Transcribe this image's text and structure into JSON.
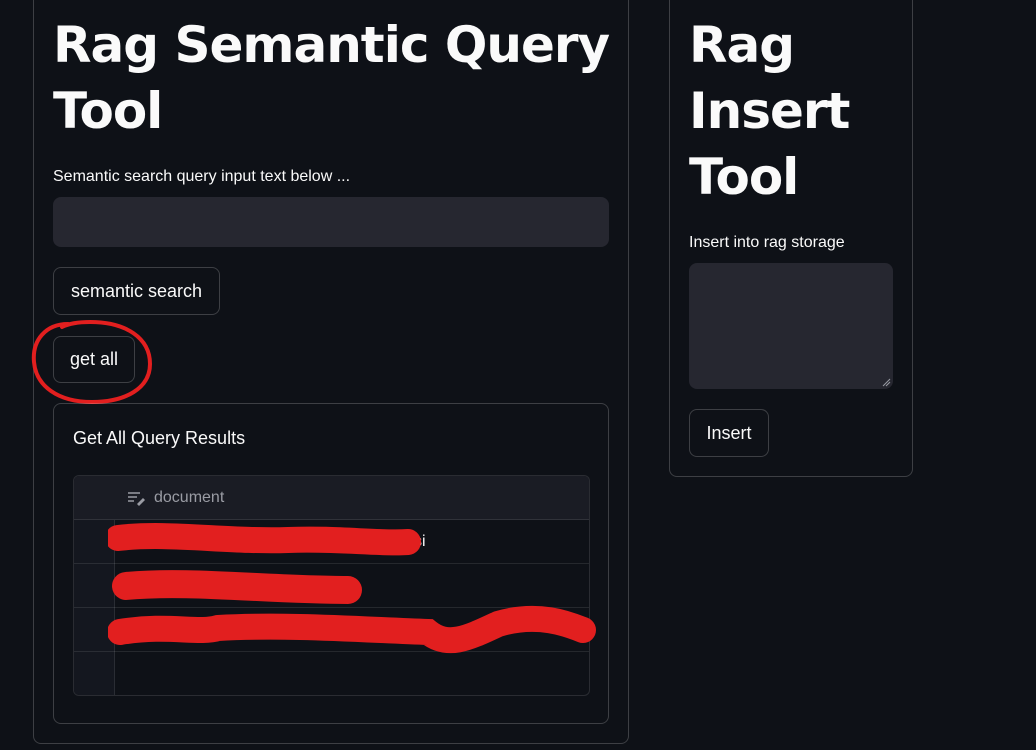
{
  "query_tool": {
    "title": "Rag Semantic Query Tool",
    "input_label": "Semantic search query input text below ...",
    "input_value": "",
    "input_placeholder": "",
    "search_button": "semantic search",
    "get_all_button": "get all",
    "results": {
      "title": "Get All Query Results",
      "columns": [
        "document"
      ],
      "rows": [
        {
          "document_visible_tail": "si",
          "redacted": true
        },
        {
          "document_visible_tail": "",
          "redacted": true
        },
        {
          "document_visible_tail": "",
          "redacted": true
        },
        {
          "document_visible_tail": "",
          "redacted": false
        }
      ]
    }
  },
  "insert_tool": {
    "title": "Rag Insert Tool",
    "textarea_label": "Insert into rag storage",
    "textarea_value": "",
    "insert_button": "Insert"
  },
  "icons": {
    "document_column": "text-column-icon",
    "resize": "resize-handle-icon"
  },
  "colors": {
    "background": "#0e1117",
    "input_background": "#262730",
    "annotation": "#e21f1f",
    "redaction": "#e21f1f"
  }
}
